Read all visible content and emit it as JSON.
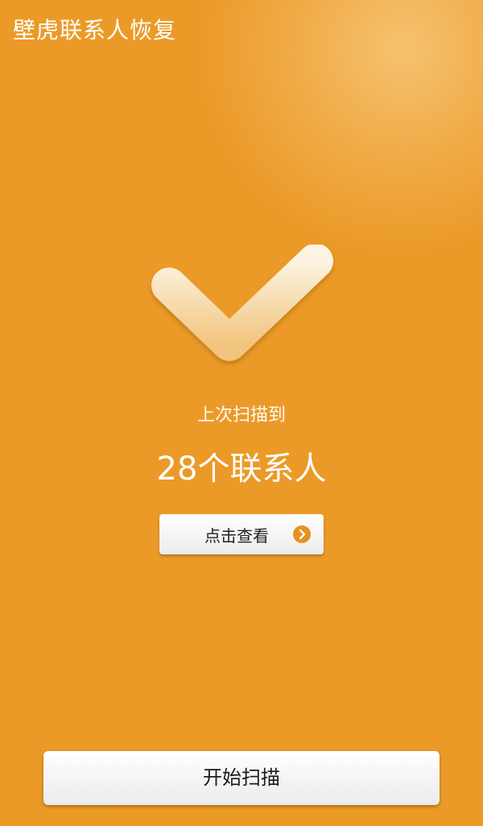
{
  "header": {
    "title": "壁虎联系人恢复"
  },
  "status": {
    "icon": "checkmark-icon",
    "label": "上次扫描到",
    "count_text": "28个联系人"
  },
  "view_button": {
    "label": "点击查看",
    "icon": "chevron-right-icon"
  },
  "scan_button": {
    "label": "开始扫描"
  },
  "colors": {
    "background": "#eb9a28",
    "accent": "#e49321",
    "button_text": "#222222",
    "title_text": "#ffffff"
  }
}
